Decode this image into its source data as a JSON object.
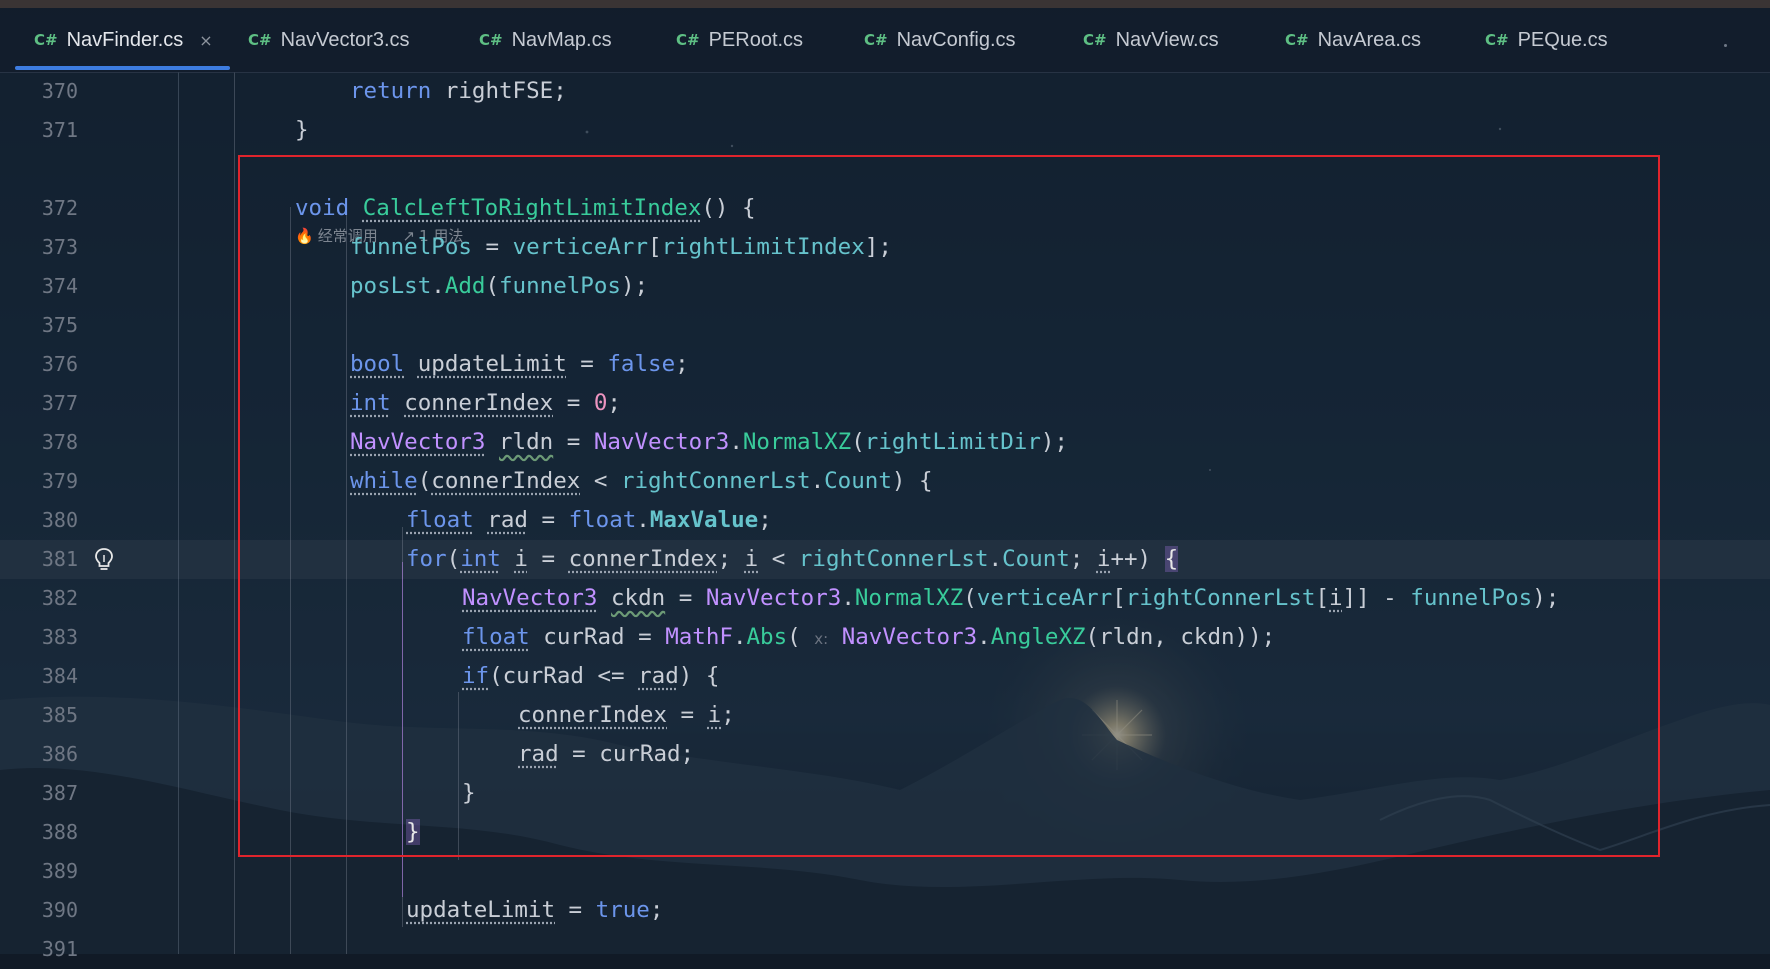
{
  "window": {
    "background": "#111a26",
    "accent": "#3d7ce0",
    "annotation_color": "#e0242c"
  },
  "tabs": [
    {
      "lang": "C#",
      "name": "NavFinder.cs",
      "active": true,
      "close": "×"
    },
    {
      "lang": "C#",
      "name": "NavVector3.cs"
    },
    {
      "lang": "C#",
      "name": "NavMap.cs"
    },
    {
      "lang": "C#",
      "name": "PERoot.cs"
    },
    {
      "lang": "C#",
      "name": "NavConfig.cs"
    },
    {
      "lang": "C#",
      "name": "NavView.cs"
    },
    {
      "lang": "C#",
      "name": "NavArea.cs"
    },
    {
      "lang": "C#",
      "name": "PEQue.cs"
    }
  ],
  "hints": {
    "usage": "经常调用",
    "usages_count": "1 用法",
    "usage_icon": "flame-icon",
    "usages_icon": "link-icon"
  },
  "gutter": {
    "bulb_icon": "lightbulb-icon",
    "bulb_line": 381
  },
  "editor": {
    "lines": [
      {
        "n": "370",
        "html": "<span class=\"kw\">return</span> rightFSE;"
      },
      {
        "n": "371",
        "html": "}"
      },
      {
        "n": "372",
        "html": "<span class=\"kw\">void</span> <span class=\"fn ul\">CalcLeftToRightLimitIndex</span>() {"
      },
      {
        "n": "373",
        "html": "<span class=\"fld\">funnelPos</span> = <span class=\"fld\">verticeArr</span>[<span class=\"fld\">rightLimitIndex</span>];"
      },
      {
        "n": "374",
        "html": "<span class=\"fld\">posLst</span>.<span class=\"fn\">Add</span>(<span class=\"fld\">funnelPos</span>);"
      },
      {
        "n": "375",
        "html": ""
      },
      {
        "n": "376",
        "html": "<span class=\"kw ul\">bool</span> <span class=\"ul\">updateLimit</span> = <span class=\"kw\">false</span>;"
      },
      {
        "n": "377",
        "html": "<span class=\"kw ul\">int</span> <span class=\"ul\">connerIndex</span> = <span class=\"num\">0</span>;"
      },
      {
        "n": "378",
        "html": "<span class=\"ty ul\">NavVector3</span> <span class=\"sq\">rldn</span> = <span class=\"ty\">NavVector3</span>.<span class=\"fn\">NormalXZ</span>(<span class=\"fld\">rightLimitDir</span>);"
      },
      {
        "n": "379",
        "html": "<span class=\"kw ul\">while</span>(<span class=\"ul\">connerIndex</span> &lt; <span class=\"fld\">rightConnerLst</span>.<span class=\"fld\">Count</span>) {"
      },
      {
        "n": "380",
        "html": "<span class=\"kw ul\">float</span> <span class=\"ul\">rad</span> = <span class=\"kw\">float</span>.<span class=\"fld\" style=\"font-weight:bold\">MaxValue</span>;"
      },
      {
        "n": "381",
        "html": "<span class=\"kw\">for</span>(<span class=\"kw ul\">int</span> <span class=\"ul\">i</span> = <span class=\"ul\">connerIndex</span>; <span class=\"ul\">i</span> &lt; <span class=\"fld\">rightConnerLst</span>.<span class=\"fld\">Count</span>; <span class=\"ul\">i</span>++) <span class=\"hl-brace\">{</span>"
      },
      {
        "n": "382",
        "html": "<span class=\"ty ul\">NavVector3</span> <span class=\"sq\">ckdn</span> = <span class=\"ty\">NavVector3</span>.<span class=\"fn\">NormalXZ</span>(<span class=\"fld\">verticeArr</span>[<span class=\"fld\">rightConnerLst</span>[<span class=\"ul\">i</span>]] - <span class=\"fld\">funnelPos</span>);"
      },
      {
        "n": "383",
        "html": "<span class=\"kw ul\">float</span> curRad = <span class=\"ty\">MathF</span>.<span class=\"fn\">Abs</span>( <span class=\"paramhint\">x:</span> <span class=\"ty\">NavVector3</span>.<span class=\"fn\">AngleXZ</span>(rldn, ckdn));"
      },
      {
        "n": "384",
        "html": "<span class=\"kw ul\">if</span>(curRad &lt;= <span class=\"ul\">rad</span>) {"
      },
      {
        "n": "385",
        "html": "<span class=\"ul\">connerIndex</span> = <span class=\"ul\">i</span>;"
      },
      {
        "n": "386",
        "html": "<span class=\"ul\">rad</span> = curRad;"
      },
      {
        "n": "387",
        "html": "}"
      },
      {
        "n": "388",
        "html": "<span class=\"hl-brace\">}</span>"
      },
      {
        "n": "389",
        "html": ""
      },
      {
        "n": "390",
        "html": "<span class=\"ul\">updateLimit</span> = <span class=\"kw\">true</span>;"
      },
      {
        "n": "391",
        "html": ""
      }
    ]
  }
}
